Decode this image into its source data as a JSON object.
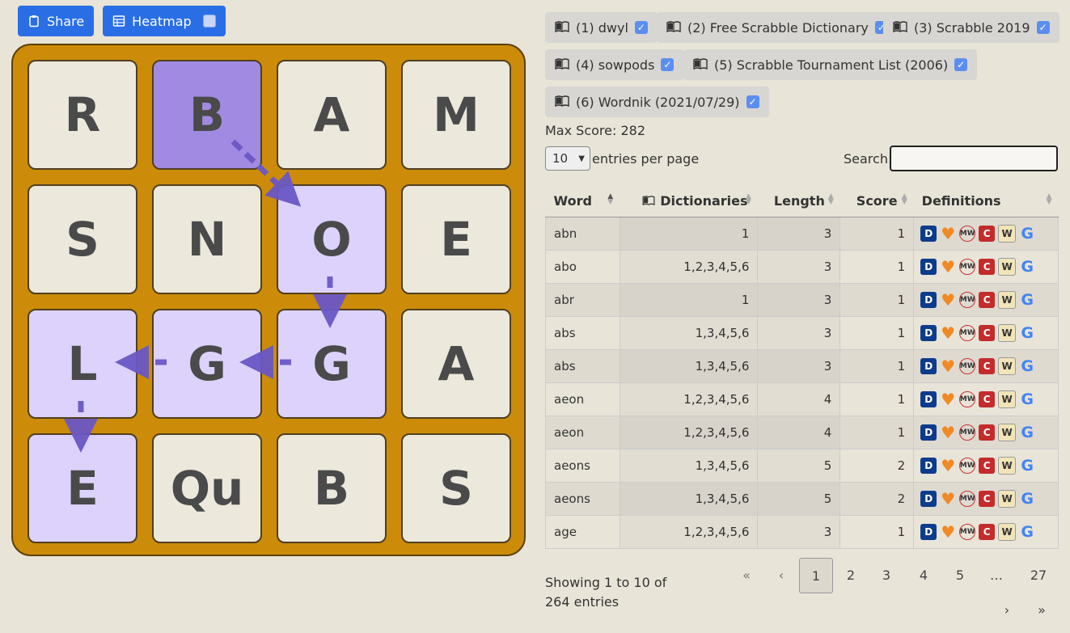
{
  "toolbar": {
    "share_label": "Share",
    "heatmap_label": "Heatmap"
  },
  "board": {
    "tiles": [
      "R",
      "B",
      "A",
      "M",
      "S",
      "N",
      "O",
      "E",
      "L",
      "G",
      "G",
      "A",
      "E",
      "Qu",
      "B",
      "S"
    ],
    "path_color": "#6b58c6",
    "start_color": "#a18ae2",
    "path_tile_color": "#dcd2fc"
  },
  "dictionaries": [
    {
      "label": "(1) dwyl",
      "checked": true
    },
    {
      "label": "(2) Free Scrabble Dictionary",
      "checked": true
    },
    {
      "label": "(3) Scrabble 2019",
      "checked": true
    },
    {
      "label": "(4) sowpods",
      "checked": true
    },
    {
      "label": "(5) Scrabble Tournament List (2006)",
      "checked": true
    },
    {
      "label": "(6) Wordnik (2021/07/29)",
      "checked": true
    }
  ],
  "stats": {
    "max_score": "Max Score: 282"
  },
  "controls": {
    "entries_value": "10",
    "entries_label": "entries per page",
    "search_label": "Search:",
    "search_value": ""
  },
  "table": {
    "headers": [
      "Word",
      "Dictionaries",
      "Length",
      "Score",
      "Definitions"
    ],
    "rows": [
      {
        "word": "abn",
        "dicts": "1",
        "length": "3",
        "score": "1"
      },
      {
        "word": "abo",
        "dicts": "1,2,3,4,5,6",
        "length": "3",
        "score": "1"
      },
      {
        "word": "abr",
        "dicts": "1",
        "length": "3",
        "score": "1"
      },
      {
        "word": "abs",
        "dicts": "1,3,4,5,6",
        "length": "3",
        "score": "1"
      },
      {
        "word": "abs",
        "dicts": "1,3,4,5,6",
        "length": "3",
        "score": "1"
      },
      {
        "word": "aeon",
        "dicts": "1,2,3,4,5,6",
        "length": "4",
        "score": "1"
      },
      {
        "word": "aeon",
        "dicts": "1,2,3,4,5,6",
        "length": "4",
        "score": "1"
      },
      {
        "word": "aeons",
        "dicts": "1,3,4,5,6",
        "length": "5",
        "score": "2"
      },
      {
        "word": "aeons",
        "dicts": "1,3,4,5,6",
        "length": "5",
        "score": "2"
      },
      {
        "word": "age",
        "dicts": "1,2,3,4,5,6",
        "length": "3",
        "score": "1"
      }
    ],
    "definition_icons": [
      "dictionary-com-icon",
      "heart-icon",
      "merriam-webster-icon",
      "collins-icon",
      "wiktionary-icon",
      "google-icon"
    ]
  },
  "footer": {
    "info": "Showing 1 to 10 of 264 entries",
    "pages": [
      "«",
      "‹",
      "1",
      "2",
      "3",
      "4",
      "5",
      "…",
      "27",
      "›",
      "»"
    ],
    "current_page": "1"
  }
}
